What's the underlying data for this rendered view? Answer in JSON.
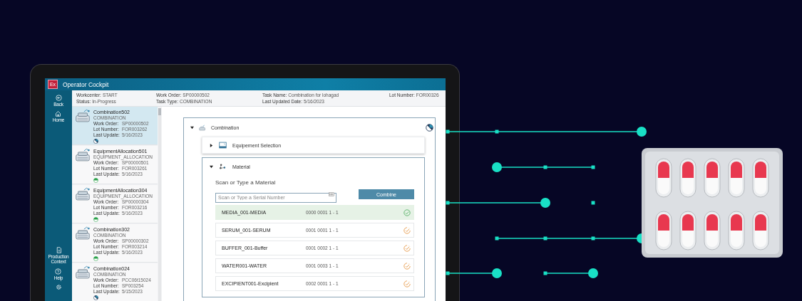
{
  "app": {
    "logo": "Ex",
    "title": "Operator Cockpit"
  },
  "nav": [
    {
      "kind": "back",
      "label": "Back"
    },
    {
      "kind": "home",
      "label": "Home"
    },
    {
      "kind": "context",
      "label": "Production Context"
    },
    {
      "kind": "help",
      "label": "Help"
    },
    {
      "kind": "settings"
    }
  ],
  "task_header": [
    [
      {
        "label": "Workcenter:",
        "value": "START"
      },
      {
        "label": "Status:",
        "value": "In-Progress"
      }
    ],
    [
      {
        "label": "Work Order:",
        "value": "SP00000502"
      },
      {
        "label": "Task Type:",
        "value": "COMBINATION"
      }
    ],
    [
      {
        "label": "Task Name:",
        "value": "Combination for lohagad"
      },
      {
        "label": "Last Updated Date:",
        "value": "5/16/2023"
      }
    ],
    [
      {
        "label": "Lot Number:",
        "value": "FOR00326"
      }
    ]
  ],
  "tasks": [
    {
      "name": "Combination502",
      "type": "COMBINATION",
      "selected": true,
      "complete": false,
      "fields": [
        {
          "label": "Work Order:",
          "value": "SP00000502"
        },
        {
          "label": "Lot Number:",
          "value": "FOR003262"
        },
        {
          "label": "Last Update:",
          "value": "5/16/2023"
        }
      ]
    },
    {
      "name": "EquipmentAllocation501",
      "type": "EQUIPMENT_ALLOCATION",
      "selected": false,
      "complete": true,
      "fields": [
        {
          "label": "Work Order:",
          "value": "SP00000501"
        },
        {
          "label": "Lot Number:",
          "value": "FOR003261"
        },
        {
          "label": "Last Update:",
          "value": "5/16/2023"
        }
      ]
    },
    {
      "name": "EquipmentAllocation304",
      "type": "EQUIPMENT_ALLOCATION",
      "selected": false,
      "complete": true,
      "fields": [
        {
          "label": "Work Order:",
          "value": "SP00000304"
        },
        {
          "label": "Lot Number:",
          "value": "FOR003216"
        },
        {
          "label": "Last Update:",
          "value": "5/16/2023"
        }
      ]
    },
    {
      "name": "Combination302",
      "type": "COMBINATION",
      "selected": false,
      "complete": true,
      "fields": [
        {
          "label": "Work Order:",
          "value": "SP00000302"
        },
        {
          "label": "Lot Number:",
          "value": "FOR003214"
        },
        {
          "label": "Last Update:",
          "value": "5/16/2023"
        }
      ]
    },
    {
      "name": "Combination024",
      "type": "COMBINATION",
      "selected": false,
      "complete": false,
      "fields": [
        {
          "label": "Work Order:",
          "value": "PCC06t15024"
        },
        {
          "label": "Lot Number:",
          "value": "SP003254"
        },
        {
          "label": "Last Update:",
          "value": "5/15/2023"
        }
      ]
    }
  ],
  "panel": {
    "title": "Combination",
    "expanded": true,
    "complete": false,
    "sections": [
      {
        "kind": "equipment",
        "title": "Equipement Selection",
        "expanded": false
      },
      {
        "kind": "material",
        "title": "Material",
        "expanded": true,
        "prompt": "Scan or Type a Material",
        "search": {
          "placeholder": "Scan or Type a Serial Number"
        },
        "button": "Combine",
        "materials": [
          {
            "name": "MEDIA_001-MEDIA",
            "code": "0000 0001 1 - 1",
            "complete": true
          },
          {
            "name": "SERUM_001-SERUM",
            "code": "0001 0001 1 - 1",
            "complete": false
          },
          {
            "name": "BUFFER_001-Buffer",
            "code": "0001 0002 1 - 1",
            "complete": false
          },
          {
            "name": "WATER001-WATER",
            "code": "0001 0003 1 - 1",
            "complete": false
          },
          {
            "name": "EXCIPIENT001-Excipient",
            "code": "0002 0001 1 - 1",
            "complete": false
          }
        ]
      }
    ]
  }
}
